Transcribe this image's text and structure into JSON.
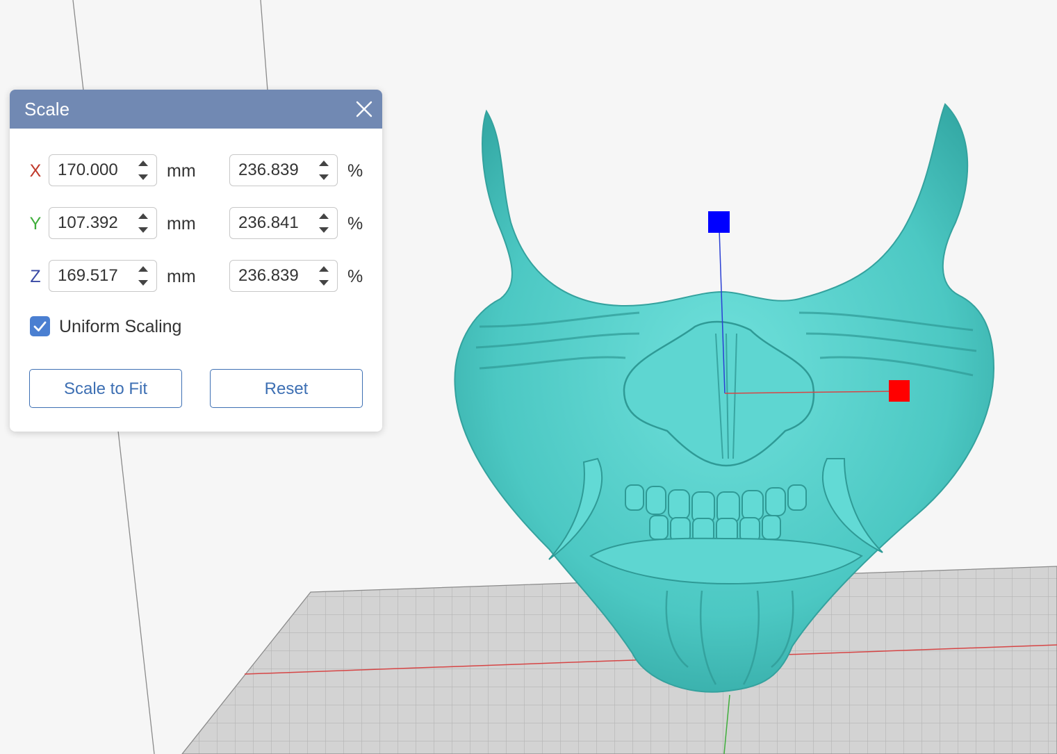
{
  "panel": {
    "title": "Scale",
    "header_color": "#7189b3",
    "rows": [
      {
        "axis": "X",
        "axis_color": "#c0392b",
        "mm": "170.000",
        "mm_unit": "mm",
        "percent": "236.839",
        "percent_unit": "%"
      },
      {
        "axis": "Y",
        "axis_color": "#3fae3b",
        "mm": "107.392",
        "mm_unit": "mm",
        "percent": "236.841",
        "percent_unit": "%"
      },
      {
        "axis": "Z",
        "axis_color": "#3a4aa5",
        "mm": "169.517",
        "mm_unit": "mm",
        "percent": "236.839",
        "percent_unit": "%"
      }
    ],
    "uniform_scaling": {
      "label": "Uniform Scaling",
      "checked": true
    },
    "buttons": {
      "scale_to_fit": "Scale to Fit",
      "reset": "Reset"
    },
    "accent_color": "#3d6fb3"
  },
  "viewport": {
    "model_color": "#57d1cc",
    "gizmo": {
      "z_handle_color": "#0000ff",
      "x_handle_color": "#ff0000"
    },
    "build_plate_color": "#cfcfcf"
  }
}
